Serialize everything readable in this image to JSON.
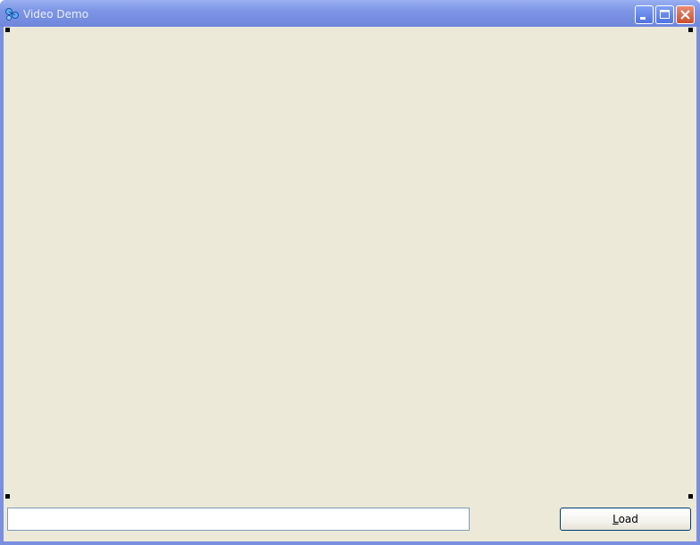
{
  "window": {
    "title": "Video Demo"
  },
  "caption_buttons": {
    "minimize": "minimize",
    "maximize": "maximize",
    "close": "close"
  },
  "form": {
    "input_value": "",
    "input_placeholder": "",
    "load_button": {
      "accelerator": "L",
      "rest": "oad"
    }
  },
  "colors": {
    "titlebar": "#7d95e6",
    "client_background": "#ece9d8",
    "close_button": "#c9502d",
    "input_border": "#7f9db9"
  }
}
